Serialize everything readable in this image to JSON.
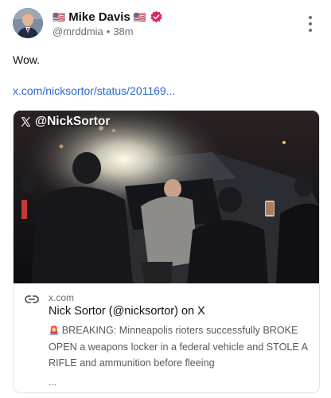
{
  "author": {
    "display_name": "Mike Davis",
    "flag_left": "🇺🇸",
    "flag_right": "🇺🇸",
    "handle": "@mrddmia",
    "separator": "•",
    "time": "38m",
    "avatar_icon": "user-avatar",
    "verified_icon": "verified-badge-icon",
    "verified_color": "#e0245e"
  },
  "post": {
    "text": "Wow.",
    "link_text": "x.com/nicksortor/status/201169..."
  },
  "card": {
    "media_label": "@NickSortor",
    "media_icon": "x-logo-icon",
    "link_icon": "link-icon",
    "domain": "x.com",
    "title": "Nick Sortor (@nicksortor) on X",
    "siren": "🚨",
    "description": "BREAKING: Minneapolis rioters successfully BROKE OPEN a weapons locker in a federal vehicle and STOLE A RIFLE and ammunition before fleeing",
    "ellipsis": "..."
  },
  "colors": {
    "link": "#2c64d6",
    "muted": "#6b6f76",
    "text": "#111111",
    "border": "#e2e4e8"
  }
}
